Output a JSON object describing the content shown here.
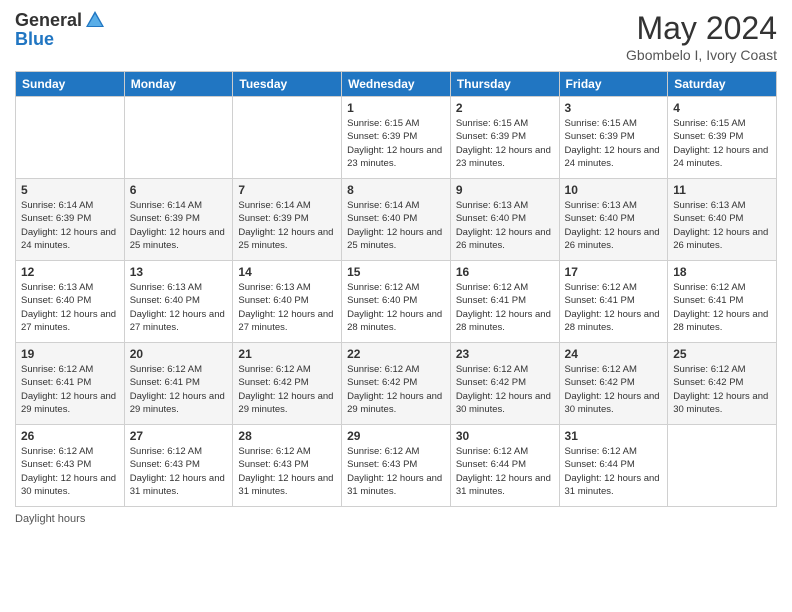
{
  "header": {
    "logo_line1": "General",
    "logo_line2": "Blue",
    "month_year": "May 2024",
    "location": "Gbombelo I, Ivory Coast"
  },
  "days_of_week": [
    "Sunday",
    "Monday",
    "Tuesday",
    "Wednesday",
    "Thursday",
    "Friday",
    "Saturday"
  ],
  "weeks": [
    [
      {
        "day": "",
        "info": ""
      },
      {
        "day": "",
        "info": ""
      },
      {
        "day": "",
        "info": ""
      },
      {
        "day": "1",
        "info": "Sunrise: 6:15 AM\nSunset: 6:39 PM\nDaylight: 12 hours and 23 minutes."
      },
      {
        "day": "2",
        "info": "Sunrise: 6:15 AM\nSunset: 6:39 PM\nDaylight: 12 hours and 23 minutes."
      },
      {
        "day": "3",
        "info": "Sunrise: 6:15 AM\nSunset: 6:39 PM\nDaylight: 12 hours and 24 minutes."
      },
      {
        "day": "4",
        "info": "Sunrise: 6:15 AM\nSunset: 6:39 PM\nDaylight: 12 hours and 24 minutes."
      }
    ],
    [
      {
        "day": "5",
        "info": "Sunrise: 6:14 AM\nSunset: 6:39 PM\nDaylight: 12 hours and 24 minutes."
      },
      {
        "day": "6",
        "info": "Sunrise: 6:14 AM\nSunset: 6:39 PM\nDaylight: 12 hours and 25 minutes."
      },
      {
        "day": "7",
        "info": "Sunrise: 6:14 AM\nSunset: 6:39 PM\nDaylight: 12 hours and 25 minutes."
      },
      {
        "day": "8",
        "info": "Sunrise: 6:14 AM\nSunset: 6:40 PM\nDaylight: 12 hours and 25 minutes."
      },
      {
        "day": "9",
        "info": "Sunrise: 6:13 AM\nSunset: 6:40 PM\nDaylight: 12 hours and 26 minutes."
      },
      {
        "day": "10",
        "info": "Sunrise: 6:13 AM\nSunset: 6:40 PM\nDaylight: 12 hours and 26 minutes."
      },
      {
        "day": "11",
        "info": "Sunrise: 6:13 AM\nSunset: 6:40 PM\nDaylight: 12 hours and 26 minutes."
      }
    ],
    [
      {
        "day": "12",
        "info": "Sunrise: 6:13 AM\nSunset: 6:40 PM\nDaylight: 12 hours and 27 minutes."
      },
      {
        "day": "13",
        "info": "Sunrise: 6:13 AM\nSunset: 6:40 PM\nDaylight: 12 hours and 27 minutes."
      },
      {
        "day": "14",
        "info": "Sunrise: 6:13 AM\nSunset: 6:40 PM\nDaylight: 12 hours and 27 minutes."
      },
      {
        "day": "15",
        "info": "Sunrise: 6:12 AM\nSunset: 6:40 PM\nDaylight: 12 hours and 28 minutes."
      },
      {
        "day": "16",
        "info": "Sunrise: 6:12 AM\nSunset: 6:41 PM\nDaylight: 12 hours and 28 minutes."
      },
      {
        "day": "17",
        "info": "Sunrise: 6:12 AM\nSunset: 6:41 PM\nDaylight: 12 hours and 28 minutes."
      },
      {
        "day": "18",
        "info": "Sunrise: 6:12 AM\nSunset: 6:41 PM\nDaylight: 12 hours and 28 minutes."
      }
    ],
    [
      {
        "day": "19",
        "info": "Sunrise: 6:12 AM\nSunset: 6:41 PM\nDaylight: 12 hours and 29 minutes."
      },
      {
        "day": "20",
        "info": "Sunrise: 6:12 AM\nSunset: 6:41 PM\nDaylight: 12 hours and 29 minutes."
      },
      {
        "day": "21",
        "info": "Sunrise: 6:12 AM\nSunset: 6:42 PM\nDaylight: 12 hours and 29 minutes."
      },
      {
        "day": "22",
        "info": "Sunrise: 6:12 AM\nSunset: 6:42 PM\nDaylight: 12 hours and 29 minutes."
      },
      {
        "day": "23",
        "info": "Sunrise: 6:12 AM\nSunset: 6:42 PM\nDaylight: 12 hours and 30 minutes."
      },
      {
        "day": "24",
        "info": "Sunrise: 6:12 AM\nSunset: 6:42 PM\nDaylight: 12 hours and 30 minutes."
      },
      {
        "day": "25",
        "info": "Sunrise: 6:12 AM\nSunset: 6:42 PM\nDaylight: 12 hours and 30 minutes."
      }
    ],
    [
      {
        "day": "26",
        "info": "Sunrise: 6:12 AM\nSunset: 6:43 PM\nDaylight: 12 hours and 30 minutes."
      },
      {
        "day": "27",
        "info": "Sunrise: 6:12 AM\nSunset: 6:43 PM\nDaylight: 12 hours and 31 minutes."
      },
      {
        "day": "28",
        "info": "Sunrise: 6:12 AM\nSunset: 6:43 PM\nDaylight: 12 hours and 31 minutes."
      },
      {
        "day": "29",
        "info": "Sunrise: 6:12 AM\nSunset: 6:43 PM\nDaylight: 12 hours and 31 minutes."
      },
      {
        "day": "30",
        "info": "Sunrise: 6:12 AM\nSunset: 6:44 PM\nDaylight: 12 hours and 31 minutes."
      },
      {
        "day": "31",
        "info": "Sunrise: 6:12 AM\nSunset: 6:44 PM\nDaylight: 12 hours and 31 minutes."
      },
      {
        "day": "",
        "info": ""
      }
    ]
  ],
  "footer": {
    "daylight_label": "Daylight hours"
  },
  "colors": {
    "header_bg": "#2176c2",
    "accent": "#1a6bb5"
  }
}
